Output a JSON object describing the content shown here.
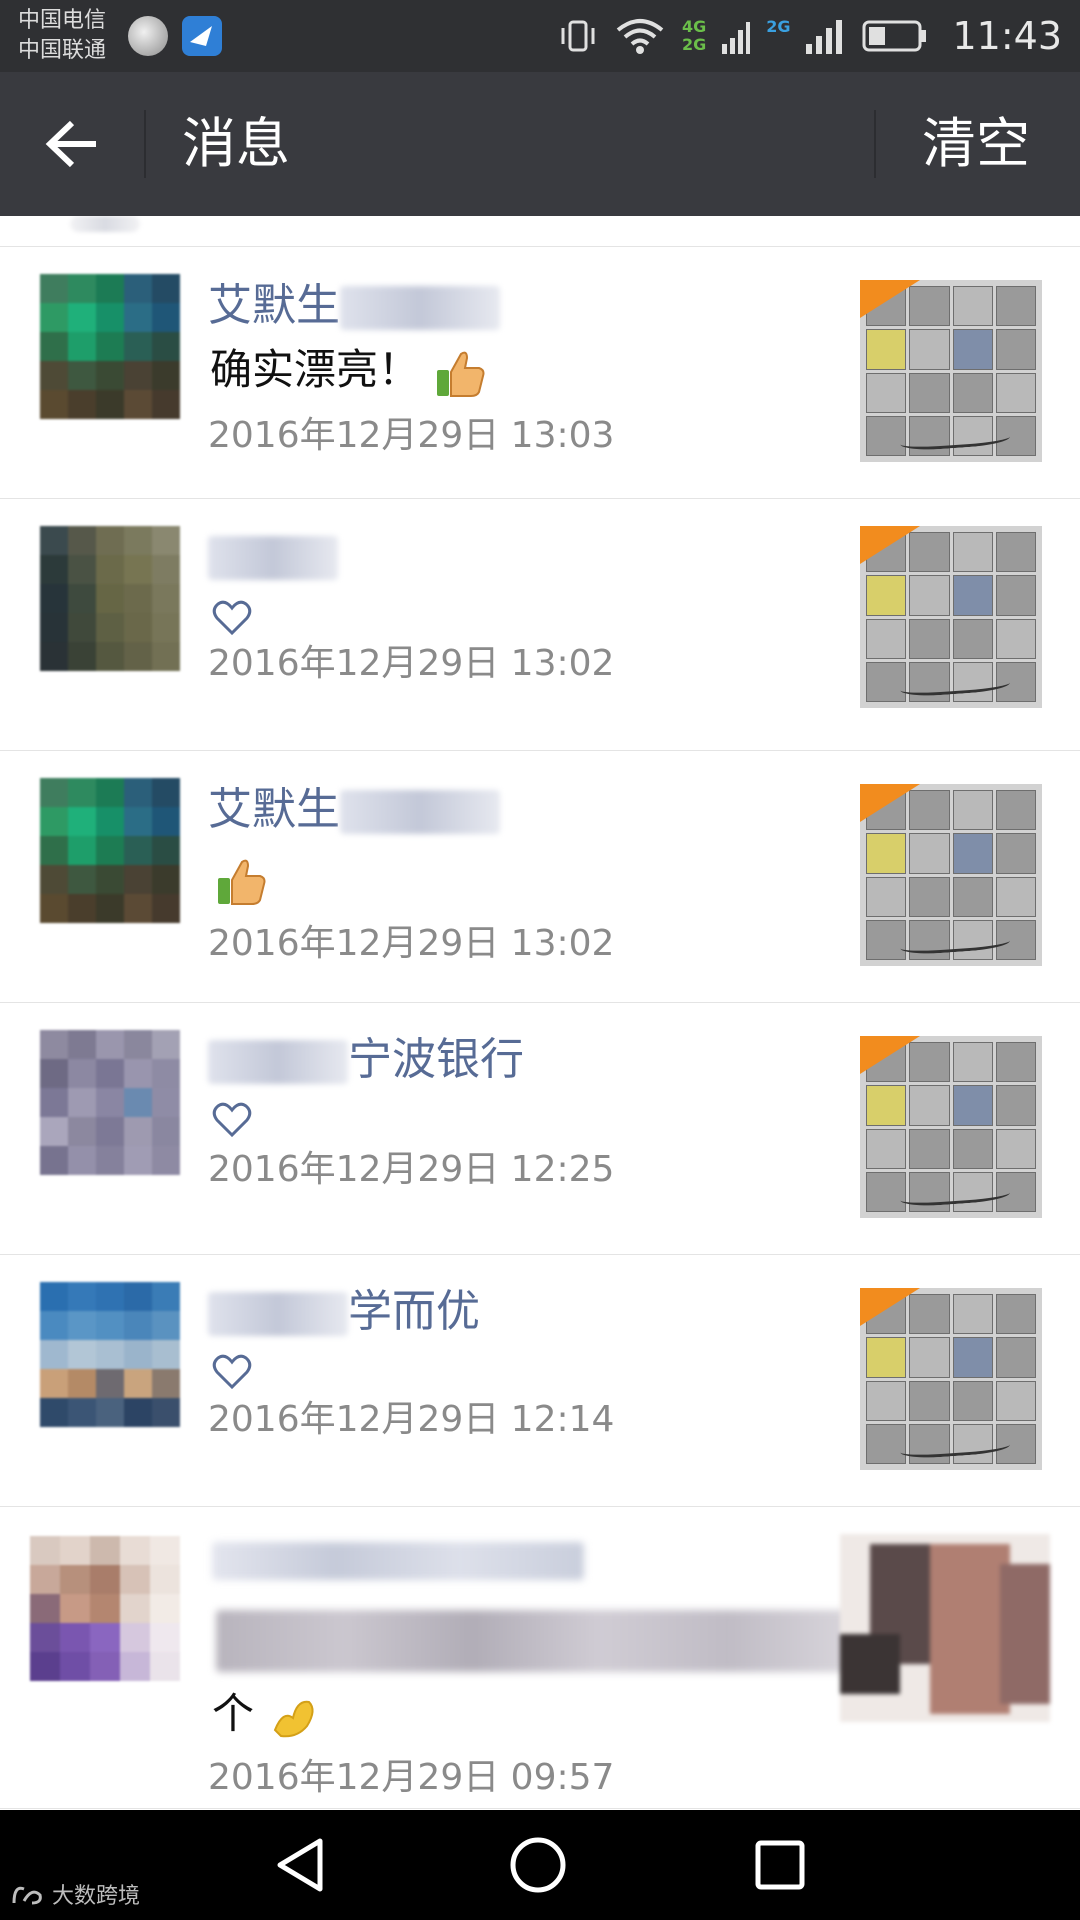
{
  "status_bar": {
    "carrier_1": "中国电信",
    "carrier_2": "中国联通",
    "network_4g": "4G",
    "network_2g_top": "2G",
    "network_2g_bottom": "2G",
    "time": "11:43"
  },
  "title_bar": {
    "title": "消息",
    "clear_label": "清空"
  },
  "messages": [
    {
      "name_visible": "艾默生",
      "content_text": "确实漂亮！",
      "reaction": "thumbs-up",
      "time": "2016年12月29日 13:03"
    },
    {
      "name_visible": "",
      "content_text": "",
      "reaction": "heart",
      "time": "2016年12月29日 13:02"
    },
    {
      "name_visible": "艾默生",
      "content_text": "",
      "reaction": "thumbs-up",
      "time": "2016年12月29日 13:02"
    },
    {
      "name_visible": "宁波银行",
      "content_text": "",
      "reaction": "heart",
      "time": "2016年12月29日 12:25"
    },
    {
      "name_visible": "学而优",
      "content_text": "",
      "reaction": "heart",
      "time": "2016年12月29日 12:14"
    },
    {
      "name_visible": "",
      "content_text": "个",
      "reaction": "strong-arm",
      "time": "2016年12月29日 09:57"
    }
  ],
  "watermark": "大数跨境",
  "colors": {
    "status_bar_bg": "#2f3033",
    "title_bar_bg": "#393a3f",
    "name_link": "#576b95",
    "timestamp": "#8a8a8a",
    "nav_bar_bg": "#000000"
  },
  "icons": [
    "back-arrow-icon",
    "heart-icon",
    "thumbs-up-icon",
    "back-triangle-icon",
    "home-circle-icon",
    "recents-square-icon"
  ]
}
